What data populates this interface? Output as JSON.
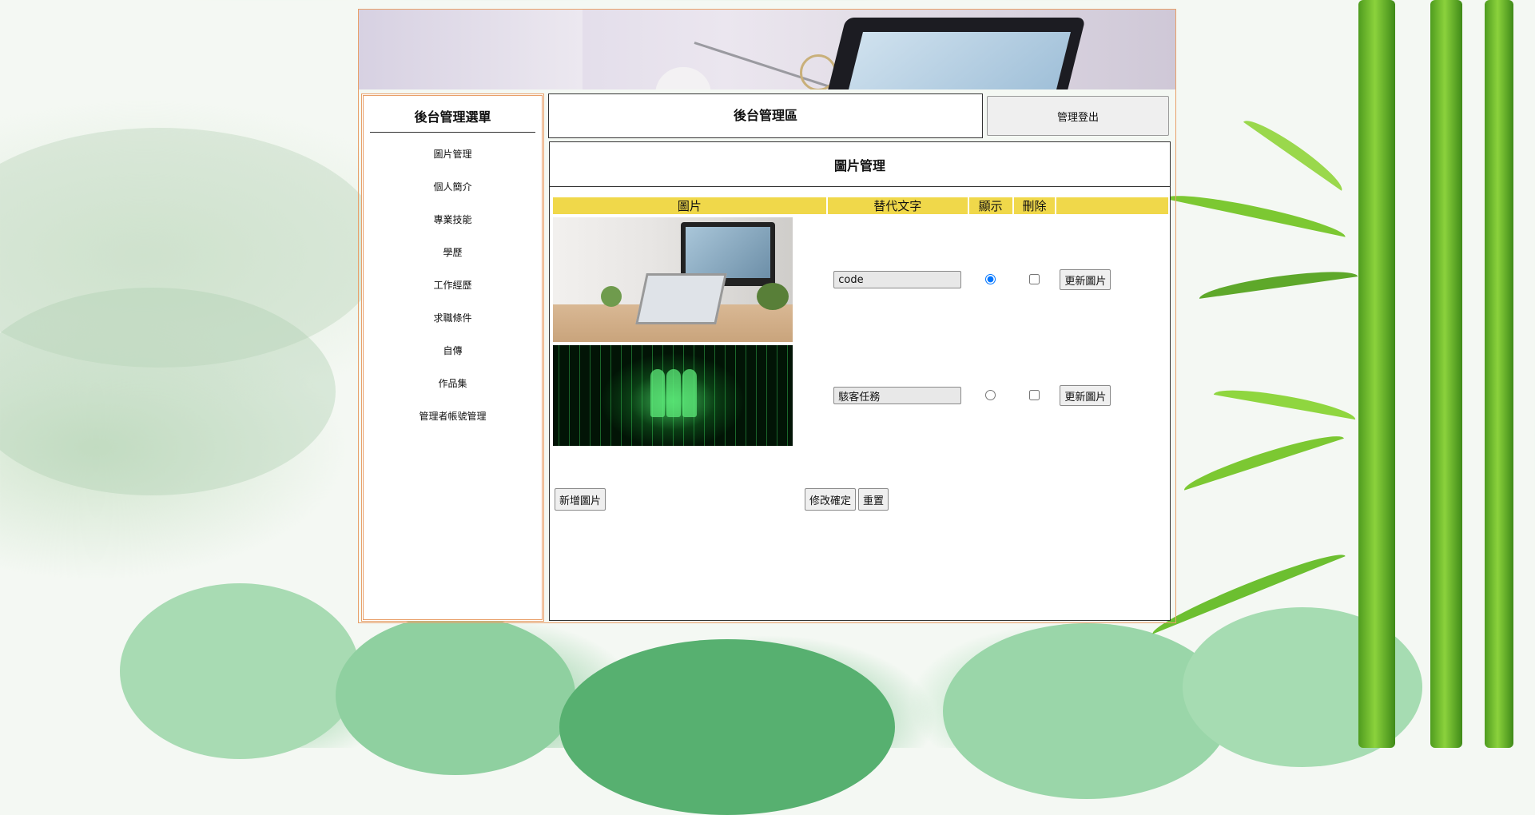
{
  "sidebar": {
    "title": "後台管理選單",
    "items": [
      {
        "label": "圖片管理"
      },
      {
        "label": "個人簡介"
      },
      {
        "label": "專業技能"
      },
      {
        "label": "學歷"
      },
      {
        "label": "工作經歷"
      },
      {
        "label": "求職條件"
      },
      {
        "label": "自傳"
      },
      {
        "label": "作品集"
      },
      {
        "label": "管理者帳號管理"
      }
    ]
  },
  "header": {
    "title": "後台管理區",
    "logout_label": "管理登出"
  },
  "panel": {
    "title": "圖片管理",
    "columns": [
      "圖片",
      "替代文字",
      "顯示",
      "刪除",
      ""
    ],
    "rows": [
      {
        "image": "office-desk-photo",
        "alt_text": "code",
        "display_selected": true,
        "delete_checked": false,
        "update_label": "更新圖片"
      },
      {
        "image": "matrix-code-photo",
        "alt_text": "駭客任務",
        "display_selected": false,
        "delete_checked": false,
        "update_label": "更新圖片"
      }
    ],
    "add_label": "新增圖片",
    "confirm_label": "修改確定",
    "reset_label": "重置"
  },
  "colors": {
    "frame_border": "#e8a06a",
    "table_header_bg": "#f0d84a"
  }
}
